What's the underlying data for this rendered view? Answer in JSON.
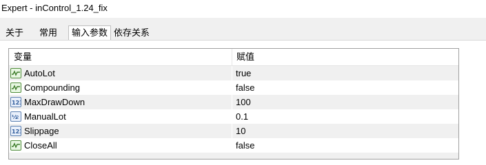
{
  "window": {
    "title": "Expert - inControl_1.24_fix"
  },
  "tabs": [
    {
      "label": "关于"
    },
    {
      "label": "常用"
    },
    {
      "label": "输入参数",
      "active": true
    },
    {
      "label": "依存关系"
    }
  ],
  "grid": {
    "columns": [
      "变量",
      "赋值"
    ],
    "rows": [
      {
        "name": "AutoLot",
        "value": "true",
        "type_icon": "bool-icon"
      },
      {
        "name": "Compounding",
        "value": "false",
        "type_icon": "bool-icon"
      },
      {
        "name": "MaxDrawDown",
        "value": "100",
        "type_icon": "int-icon"
      },
      {
        "name": "ManualLot",
        "value": "0.1",
        "type_icon": "double-icon"
      },
      {
        "name": "Slippage",
        "value": "10",
        "type_icon": "int-icon"
      },
      {
        "name": "CloseAll",
        "value": "false",
        "type_icon": "bool-icon"
      }
    ]
  },
  "colors": {
    "alt_row": "#f0f0f0",
    "bool_icon_green": "#4f8c3a",
    "int_icon_blue": "#5b7fb0"
  }
}
